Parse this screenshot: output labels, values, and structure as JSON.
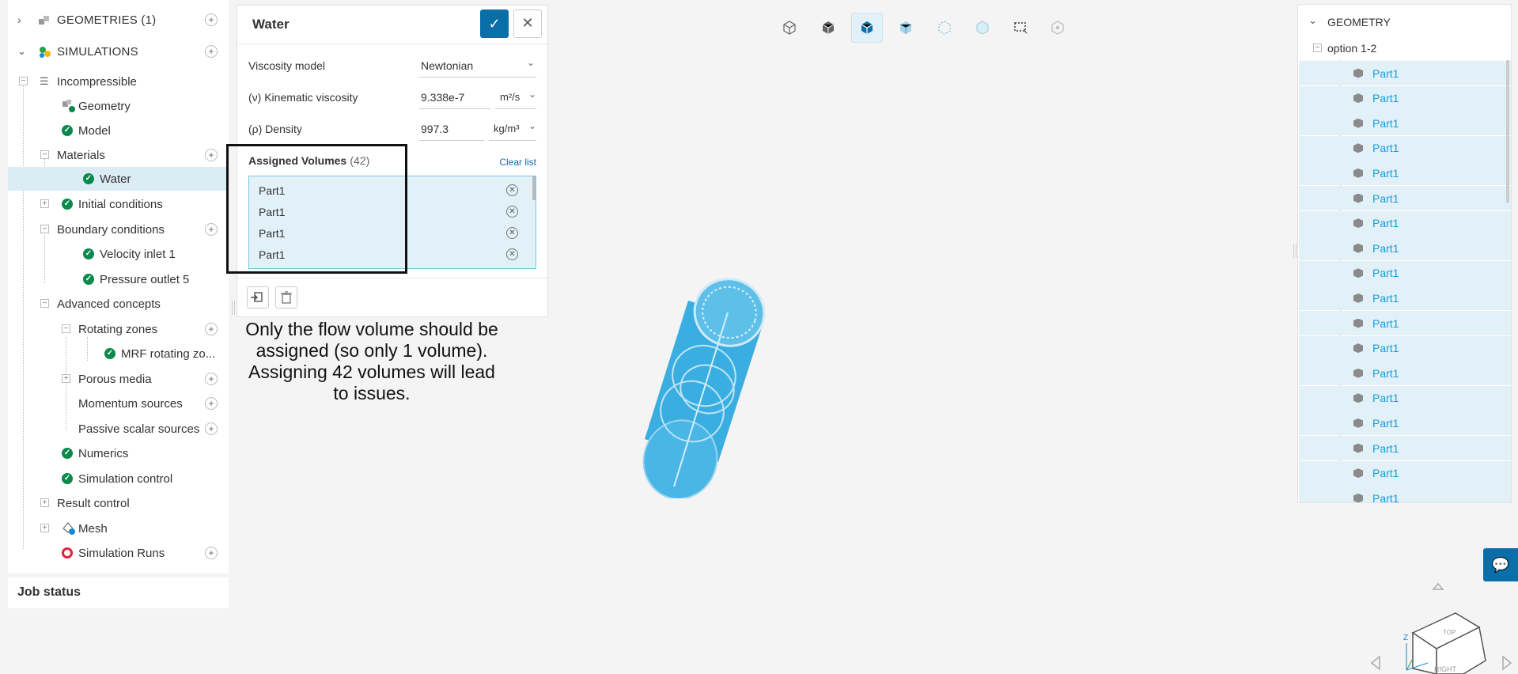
{
  "tree": {
    "geometries_label": "GEOMETRIES (1)",
    "simulations_label": "SIMULATIONS",
    "items": [
      {
        "label": "Incompressible"
      },
      {
        "label": "Geometry"
      },
      {
        "label": "Model"
      },
      {
        "label": "Materials"
      },
      {
        "label": "Water"
      },
      {
        "label": "Initial conditions"
      },
      {
        "label": "Boundary conditions"
      },
      {
        "label": "Velocity inlet 1"
      },
      {
        "label": "Pressure outlet 5"
      },
      {
        "label": "Advanced concepts"
      },
      {
        "label": "Rotating zones"
      },
      {
        "label": "MRF rotating zo..."
      },
      {
        "label": "Porous media"
      },
      {
        "label": "Momentum sources"
      },
      {
        "label": "Passive scalar sources"
      },
      {
        "label": "Numerics"
      },
      {
        "label": "Simulation control"
      },
      {
        "label": "Result control"
      },
      {
        "label": "Mesh"
      },
      {
        "label": "Simulation Runs"
      }
    ]
  },
  "job_status": "Job status",
  "dialog": {
    "title": "Water",
    "viscosity_model_label": "Viscosity model",
    "viscosity_model_value": "Newtonian",
    "kinematic_label": "(ν) Kinematic viscosity",
    "kinematic_value": "9.338e-7",
    "kinematic_unit": "m²/s",
    "density_label": "(ρ) Density",
    "density_value": "997.3",
    "density_unit": "kg/m³",
    "assigned_label": "Assigned Volumes",
    "assigned_count": "(42)",
    "clear_list": "Clear list",
    "volumes": [
      "Part1",
      "Part1",
      "Part1",
      "Part1"
    ]
  },
  "annotation": "Only the flow volume should be assigned (so only 1 volume). Assigning 42 volumes will lead to issues.",
  "geometry_panel": {
    "title": "GEOMETRY",
    "root": "option 1-2",
    "parts": [
      "Part1",
      "Part1",
      "Part1",
      "Part1",
      "Part1",
      "Part1",
      "Part1",
      "Part1",
      "Part1",
      "Part1",
      "Part1",
      "Part1",
      "Part1",
      "Part1",
      "Part1",
      "Part1",
      "Part1",
      "Part1"
    ]
  },
  "viewcube": {
    "top": "TOP",
    "right": "RIGHT",
    "axis_z": "Z"
  },
  "colors": {
    "accent": "#0a6fa8",
    "check": "#0a8a4a",
    "part_link": "#1a9ad6",
    "model": "#3aaee0"
  }
}
